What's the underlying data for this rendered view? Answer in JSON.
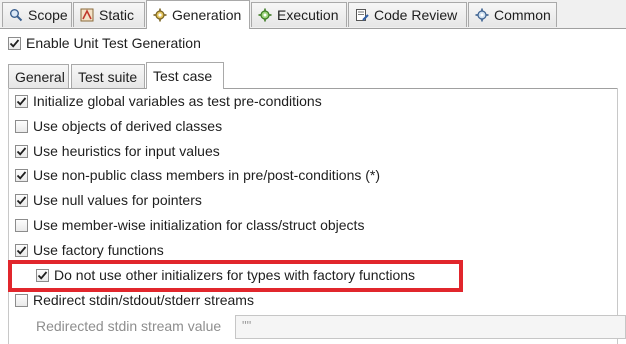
{
  "top_tabs": [
    {
      "label": "Scope",
      "icon": "scope-icon"
    },
    {
      "label": "Static",
      "icon": "static-icon"
    },
    {
      "label": "Generation",
      "icon": "generation-icon",
      "active": true
    },
    {
      "label": "Execution",
      "icon": "execution-icon"
    },
    {
      "label": "Code Review",
      "icon": "code-review-icon"
    },
    {
      "label": "Common",
      "icon": "common-icon"
    }
  ],
  "enable_generation": {
    "label": "Enable Unit Test Generation",
    "checked": true
  },
  "sub_tabs": [
    {
      "label": "General"
    },
    {
      "label": "Test suite"
    },
    {
      "label": "Test case",
      "active": true
    }
  ],
  "options": [
    {
      "label": "Initialize global variables as test pre-conditions",
      "checked": true
    },
    {
      "label": "Use objects of derived classes",
      "checked": false
    },
    {
      "label": "Use heuristics for input values",
      "checked": true
    },
    {
      "label": "Use non-public class members in pre/post-conditions (*)",
      "checked": true
    },
    {
      "label": "Use null values for pointers",
      "checked": true
    },
    {
      "label": "Use member-wise initialization for class/struct objects",
      "checked": false
    },
    {
      "label": "Use factory functions",
      "checked": true
    },
    {
      "label": "Do not use other initializers for types with factory functions",
      "checked": true
    },
    {
      "label": "Redirect stdin/stdout/stderr streams",
      "checked": false
    }
  ],
  "stdin_field": {
    "label": "Redirected stdin stream value",
    "value": "\"\""
  },
  "colors": {
    "highlight": "#e1262c",
    "check": "#1f1f1f"
  }
}
